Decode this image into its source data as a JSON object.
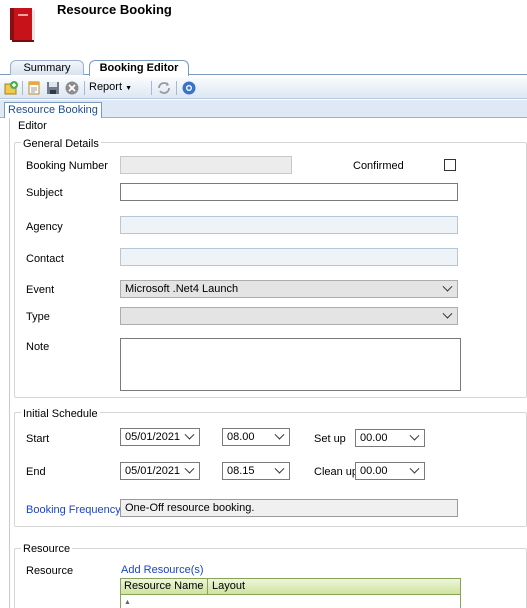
{
  "app": {
    "title": "Resource Booking",
    "icon": "book-icon"
  },
  "tabs": [
    {
      "label": "Summary"
    },
    {
      "label": "Booking Editor",
      "active": true
    }
  ],
  "toolbar": {
    "report_label": "Report"
  },
  "inner_tab": {
    "label": "Resource Booking"
  },
  "editor": {
    "legend": "Editor",
    "general": {
      "legend": "General Details",
      "booking_number_label": "Booking Number",
      "booking_number_value": "",
      "confirmed_label": "Confirmed",
      "confirmed_checked": false,
      "subject_label": "Subject",
      "subject_value": "",
      "agency_label": "Agency",
      "agency_value": "",
      "contact_label": "Contact",
      "contact_value": "",
      "event_label": "Event",
      "event_value": "Microsoft .Net4 Launch",
      "type_label": "Type",
      "type_value": "",
      "note_label": "Note",
      "note_value": ""
    },
    "schedule": {
      "legend": "Initial Schedule",
      "start_label": "Start",
      "start_date": "05/01/2021",
      "start_time": "08.00",
      "setup_label": "Set up",
      "setup_value": "00.00",
      "end_label": "End",
      "end_date": "05/01/2021",
      "end_time": "08.15",
      "cleanup_label": "Clean up",
      "cleanup_value": "00.00",
      "frequency_label": "Booking Frequency",
      "frequency_value": "One-Off resource booking."
    },
    "resource": {
      "legend": "Resource",
      "resource_label": "Resource",
      "add_link": "Add Resource(s)",
      "columns": [
        "Resource Name",
        "Layout"
      ]
    }
  },
  "colors": {
    "accent": "#1a44c7",
    "grid_header": "#cfe39c",
    "tab_border": "#7a9ac0"
  }
}
